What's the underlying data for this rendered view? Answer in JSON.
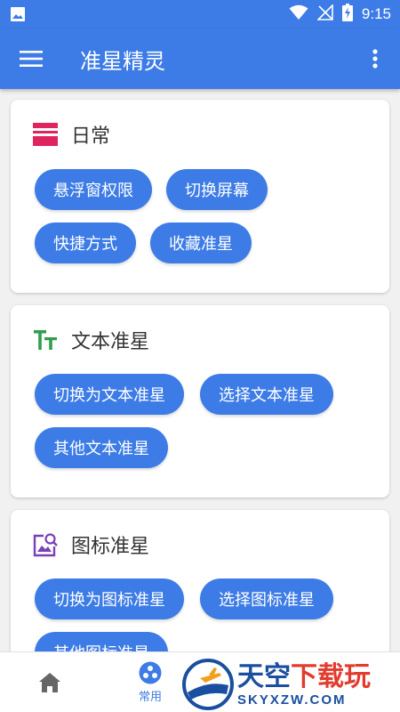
{
  "status_bar": {
    "time": "9:15"
  },
  "app_bar": {
    "title": "准星精灵"
  },
  "cards": [
    {
      "title": "日常",
      "icon": "daily-icon",
      "buttons": [
        "悬浮窗权限",
        "切换屏幕",
        "快捷方式",
        "收藏准星"
      ]
    },
    {
      "title": "文本准星",
      "icon": "text-icon",
      "buttons": [
        "切换为文本准星",
        "选择文本准星",
        "其他文本准星"
      ]
    },
    {
      "title": "图标准星",
      "icon": "image-icon",
      "buttons": [
        "切换为图标准星",
        "选择图标准星",
        "其他图标准星"
      ]
    }
  ],
  "bottom_nav": {
    "items": [
      {
        "icon": "home-icon",
        "label": ""
      },
      {
        "icon": "common-icon",
        "label": "常用"
      }
    ]
  },
  "watermark": {
    "title_part1": "天空",
    "title_part2": "下载玩",
    "subtitle": "SKYXZW.COM"
  },
  "colors": {
    "primary": "#3d7ce6",
    "daily_icon": "#e0245e",
    "text_icon": "#2e9e4f",
    "image_icon": "#7b3fb8"
  }
}
